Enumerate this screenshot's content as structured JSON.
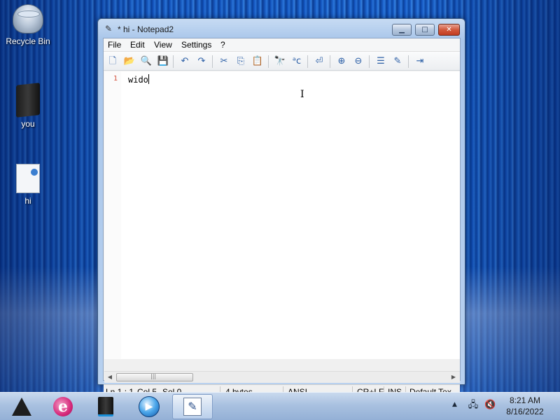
{
  "desktop": {
    "icons": [
      {
        "label": "Recycle Bin",
        "icon": "recycle-bin-icon"
      },
      {
        "label": "you",
        "icon": "folder-icon"
      },
      {
        "label": "hi",
        "icon": "text-file-shortcut-icon"
      }
    ]
  },
  "window": {
    "title": "* hi - Notepad2",
    "icon": "notepad2-icon",
    "controls": {
      "minimize": "minimize-icon",
      "maximize": "maximize-icon",
      "close": "close-icon"
    },
    "menu": [
      "File",
      "Edit",
      "View",
      "Settings",
      "?"
    ],
    "toolbar": [
      "new-icon",
      "open-icon",
      "browse-icon",
      "save-icon",
      "undo-icon",
      "redo-icon",
      "cut-icon",
      "copy-icon",
      "paste-icon",
      "find-icon",
      "replace-icon",
      "word-wrap-icon",
      "zoom-in-icon",
      "zoom-out-icon",
      "scheme-icon",
      "customize-schemes-icon",
      "exit-icon"
    ],
    "editor": {
      "lines": [
        {
          "number": "1",
          "text": "wido"
        }
      ]
    },
    "statusbar": {
      "position": "Ln 1 : 1",
      "column": "Col 5",
      "selection": "Sel 0",
      "size": "4 bytes",
      "encoding": "ANSI",
      "line_endings": "CR+LF",
      "insert_mode": "INS",
      "scheme": "Default Tex"
    }
  },
  "taskbar": {
    "apps": [
      "start-logo-icon",
      "internet-explorer-icon",
      "drive-icon",
      "media-player-icon",
      "notepad2-icon"
    ],
    "tray": [
      "show-hidden-icons-arrow",
      "network-icon",
      "volume-muted-icon"
    ],
    "clock": {
      "time": "8:21 AM",
      "date": "8/16/2022"
    }
  }
}
